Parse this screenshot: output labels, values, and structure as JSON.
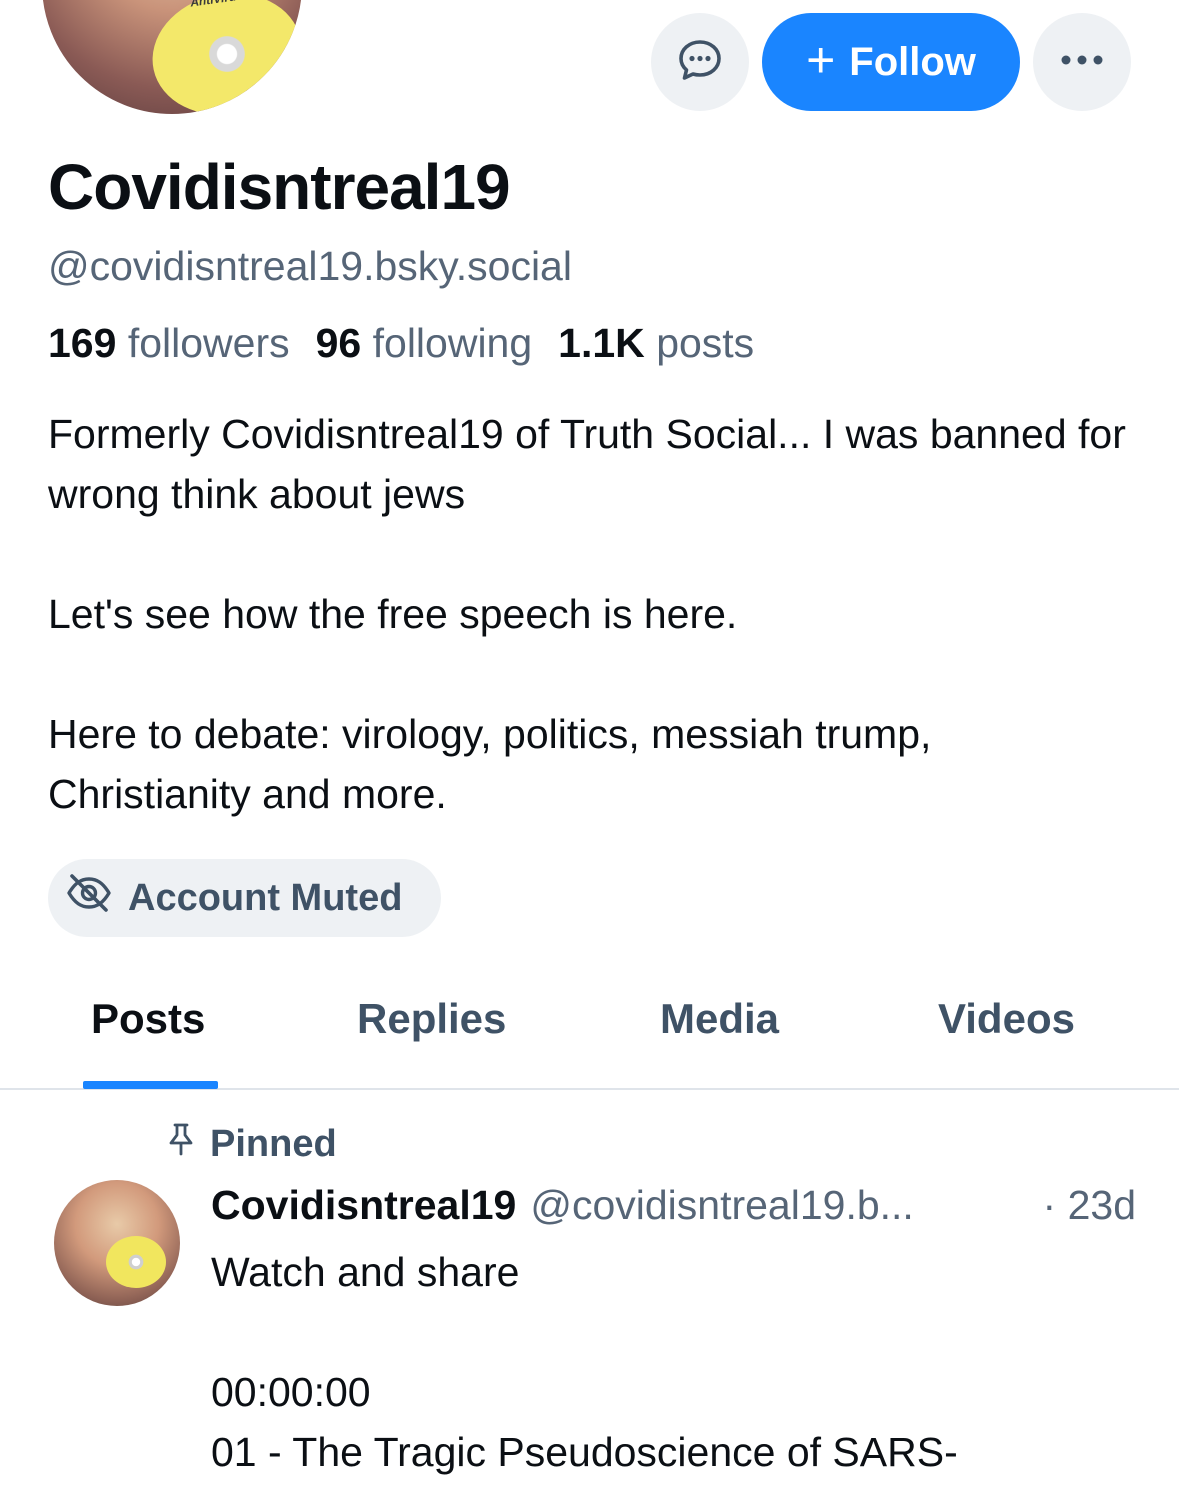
{
  "profile": {
    "avatar_label": "AntiVirus",
    "display_name": "Covidisntreal19",
    "handle": "@covidisntreal19.bsky.social",
    "stats": {
      "followers_count": "169",
      "followers_label": "followers",
      "following_count": "96",
      "following_label": "following",
      "posts_count": "1.1K",
      "posts_label": "posts"
    },
    "bio": "Formerly Covidisntreal19 of Truth Social... I was banned for wrong think about jews\n\nLet's see how the free speech is here.\n\nHere to debate: virology, politics, messiah trump, Christianity and more.",
    "muted_label": "Account Muted"
  },
  "actions": {
    "message_icon": "chat-bubble-icon",
    "follow_label": "Follow",
    "more_icon": "ellipsis-icon"
  },
  "tabs": [
    {
      "label": "Posts",
      "active": true
    },
    {
      "label": "Replies",
      "active": false
    },
    {
      "label": "Media",
      "active": false
    },
    {
      "label": "Videos",
      "active": false
    }
  ],
  "post": {
    "pinned_label": "Pinned",
    "author_name": "Covidisntreal19",
    "author_handle": "@covidisntreal19.b...",
    "time": "· 23d",
    "text": "Watch and share\n\n00:00:00\n01 - The Tragic Pseudoscience of SARS-"
  },
  "colors": {
    "accent": "#1a85ff",
    "muted_text": "#566577",
    "pill_bg": "#eef1f4"
  }
}
